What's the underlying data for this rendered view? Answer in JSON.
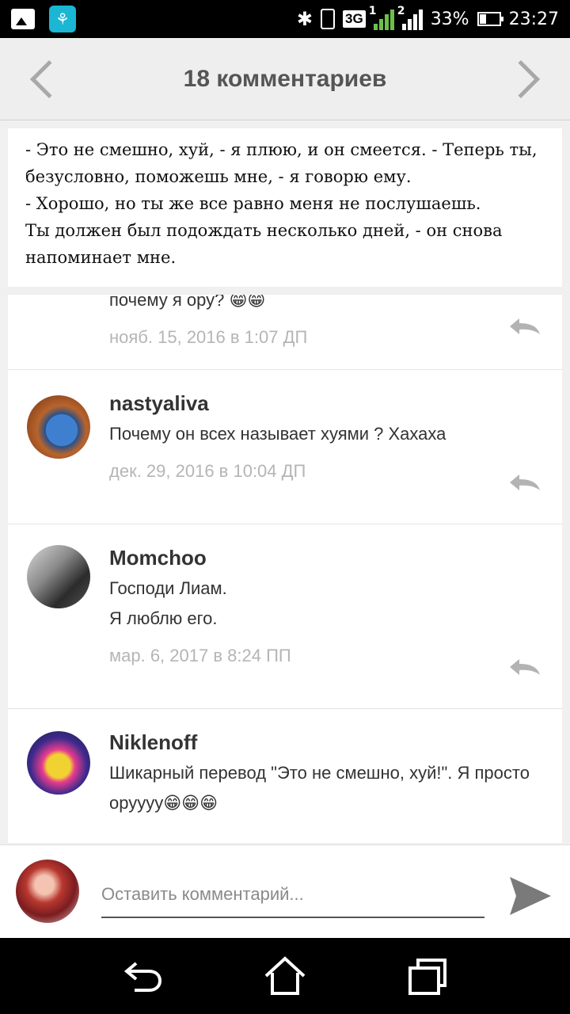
{
  "status_bar": {
    "network": "3G",
    "sim1": "1",
    "sim2": "2",
    "battery": "33%",
    "time": "23:27"
  },
  "header": {
    "title": "18 комментариев"
  },
  "post": {
    "lines": [
      "- Это не смешно, хуй, - я плюю, и он смеется. - Теперь ты, безусловно, поможешь мне, - я говорю ему.",
      "- Хорошо, но ты же все равно меня не послушаешь.",
      "Ты должен был подождать несколько дней, - он снова напоминает мне."
    ]
  },
  "comments": [
    {
      "author": "",
      "text": [
        "почему я ору? 😁😁"
      ],
      "date": "нояб. 15, 2016 в 1:07 ДП"
    },
    {
      "author": "nastyaliva",
      "text": [
        "Почему он всех называет хуями ? Хахаха"
      ],
      "date": "дек. 29, 2016 в 10:04 ДП"
    },
    {
      "author": "Momchoo",
      "text": [
        "Господи Лиам.",
        "Я люблю его."
      ],
      "date": "мар. 6, 2017 в 8:24 ПП"
    },
    {
      "author": "Niklenoff",
      "text": [
        "Шикарный перевод \"Это не смешно, хуй!\". Я просто оруууу😁😁😁"
      ],
      "date": ""
    }
  ],
  "compose": {
    "placeholder": "Оставить комментарий..."
  },
  "colors": {
    "accent_text": "#555555",
    "muted_date": "#b5b5b5",
    "app_icon": "#1ab6d4"
  },
  "icons": [
    "gallery-icon",
    "app-icon",
    "bluetooth-icon",
    "vibrate-icon",
    "signal-icon",
    "battery-icon",
    "chevron-left-icon",
    "chevron-right-icon",
    "reply-icon",
    "send-icon",
    "back-icon",
    "home-icon",
    "recents-icon"
  ]
}
